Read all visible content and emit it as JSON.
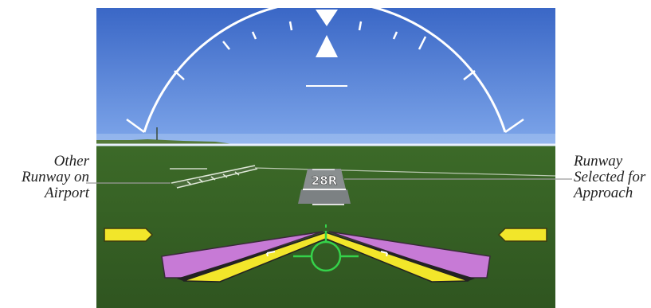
{
  "display": {
    "runway_label": "28R",
    "colors": {
      "sky_top": "#3a67c6",
      "sky_bottom": "#6f9ae3",
      "ground": "#355e22",
      "magenta": "#c77ad6",
      "yellow": "#f2e62a",
      "green_symbol": "#35d24a",
      "white": "#ffffff"
    },
    "icons": [
      "roll-pointer-icon",
      "slip-indicator-icon",
      "flight-path-marker-icon",
      "aircraft-symbol-icon",
      "command-bars-icon"
    ]
  },
  "callouts": {
    "left": {
      "lines": [
        "Other",
        "Runway on",
        "Airport"
      ]
    },
    "right": {
      "lines": [
        "Runway",
        "Selected for",
        "Approach"
      ]
    }
  }
}
